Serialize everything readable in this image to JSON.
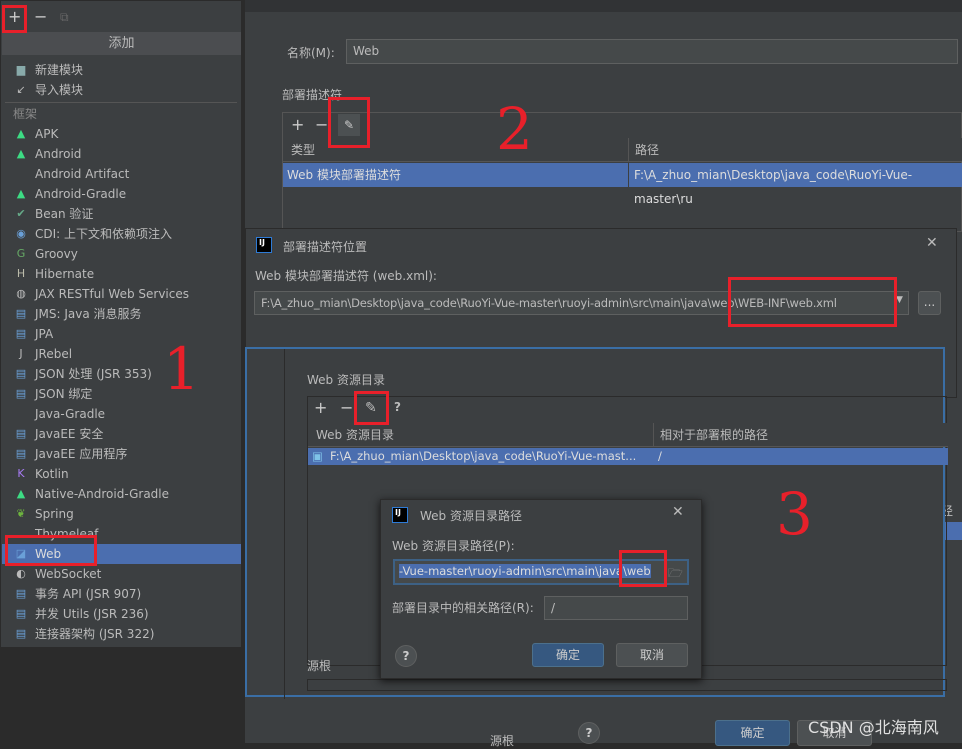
{
  "left_toolbar": {
    "add": "+",
    "remove": "−",
    "copy": "⧉"
  },
  "add_menu": {
    "title": "添加",
    "section": "框架",
    "top_items": [
      {
        "label": "新建模块",
        "icon": "folder-icon"
      },
      {
        "label": "导入模块",
        "icon": "import-icon"
      }
    ],
    "items": [
      {
        "label": "APK",
        "icon": "android-icon"
      },
      {
        "label": "Android",
        "icon": "android-icon"
      },
      {
        "label": "Android Artifact",
        "icon": ""
      },
      {
        "label": "Android-Gradle",
        "icon": "android-icon"
      },
      {
        "label": "Bean 验证",
        "icon": "bean-icon"
      },
      {
        "label": "CDI: 上下文和依赖项注入",
        "icon": "cdi-icon"
      },
      {
        "label": "Groovy",
        "icon": "groovy-icon"
      },
      {
        "label": "Hibernate",
        "icon": "hibernate-icon"
      },
      {
        "label": "JAX RESTful Web Services",
        "icon": "globe-icon"
      },
      {
        "label": "JMS: Java 消息服务",
        "icon": "jms-icon"
      },
      {
        "label": "JPA",
        "icon": "jpa-icon"
      },
      {
        "label": "JRebel",
        "icon": "jrebel-icon"
      },
      {
        "label": "JSON 处理 (JSR 353)",
        "icon": "json-icon"
      },
      {
        "label": "JSON 绑定",
        "icon": "json-icon"
      },
      {
        "label": "Java-Gradle",
        "icon": ""
      },
      {
        "label": "JavaEE 安全",
        "icon": "javaee-icon"
      },
      {
        "label": "JavaEE 应用程序",
        "icon": "javaee-icon"
      },
      {
        "label": "Kotlin",
        "icon": "kotlin-icon"
      },
      {
        "label": "Native-Android-Gradle",
        "icon": "android-icon"
      },
      {
        "label": "Spring",
        "icon": "spring-icon"
      },
      {
        "label": "Thymeleaf",
        "icon": ""
      },
      {
        "label": "Web",
        "icon": "web-icon"
      },
      {
        "label": "WebSocket",
        "icon": "websocket-icon"
      },
      {
        "label": "事务 API (JSR 907)",
        "icon": "javaee-icon"
      },
      {
        "label": "并发 Utils (JSR 236)",
        "icon": "javaee-icon"
      },
      {
        "label": "连接器架构 (JSR 322)",
        "icon": "javaee-icon"
      }
    ],
    "selected": "Web"
  },
  "module": {
    "name_label": "名称(M):",
    "name_value": "Web",
    "descriptors_title": "部署描述符",
    "col_type": "类型",
    "col_path": "路径",
    "row_type": "Web 模块部署描述符",
    "row_path": "F:\\A_zhuo_mian\\Desktop\\java_code\\RuoYi-Vue-master\\ru"
  },
  "descriptor_dialog": {
    "title": "部署描述符位置",
    "label": "Web 模块部署描述符 (web.xml):",
    "value": "F:\\A_zhuo_mian\\Desktop\\java_code\\RuoYi-Vue-master\\ruoyi-admin\\src\\main\\java\\web\\WEB-INF\\web.xml",
    "browse": "...",
    "close": "✕"
  },
  "resources": {
    "title": "Web 资源目录",
    "help": "?",
    "col_dir": "Web 资源目录",
    "col_rel": "相对于部署根的路径",
    "row_dir": "F:\\A_zhuo_mian\\Desktop\\java_code\\RuoYi-Vue-mast...",
    "row_rel": "/",
    "source_roots": "源根",
    "bg_col_frag": "径"
  },
  "path_dialog": {
    "title": "Web 资源目录路径",
    "path_label": "Web 资源目录路径(P):",
    "path_value": "-Vue-master\\ruoyi-admin\\src\\main\\java\\web",
    "rel_label": "部署目录中的相关路径(R):",
    "rel_value": "/",
    "ok": "确定",
    "cancel": "取消",
    "help": "?",
    "close": "✕"
  },
  "bottom": {
    "ok": "确定",
    "cancel": "取消",
    "help": "?",
    "source_roots": "源根"
  },
  "annotations": {
    "n1": "1",
    "n2": "2",
    "n3": "3"
  },
  "watermark": "CSDN @北海南风",
  "colors": {
    "accent": "#4b6eaf",
    "annotation": "#e8202a",
    "background": "#3c3f41"
  }
}
